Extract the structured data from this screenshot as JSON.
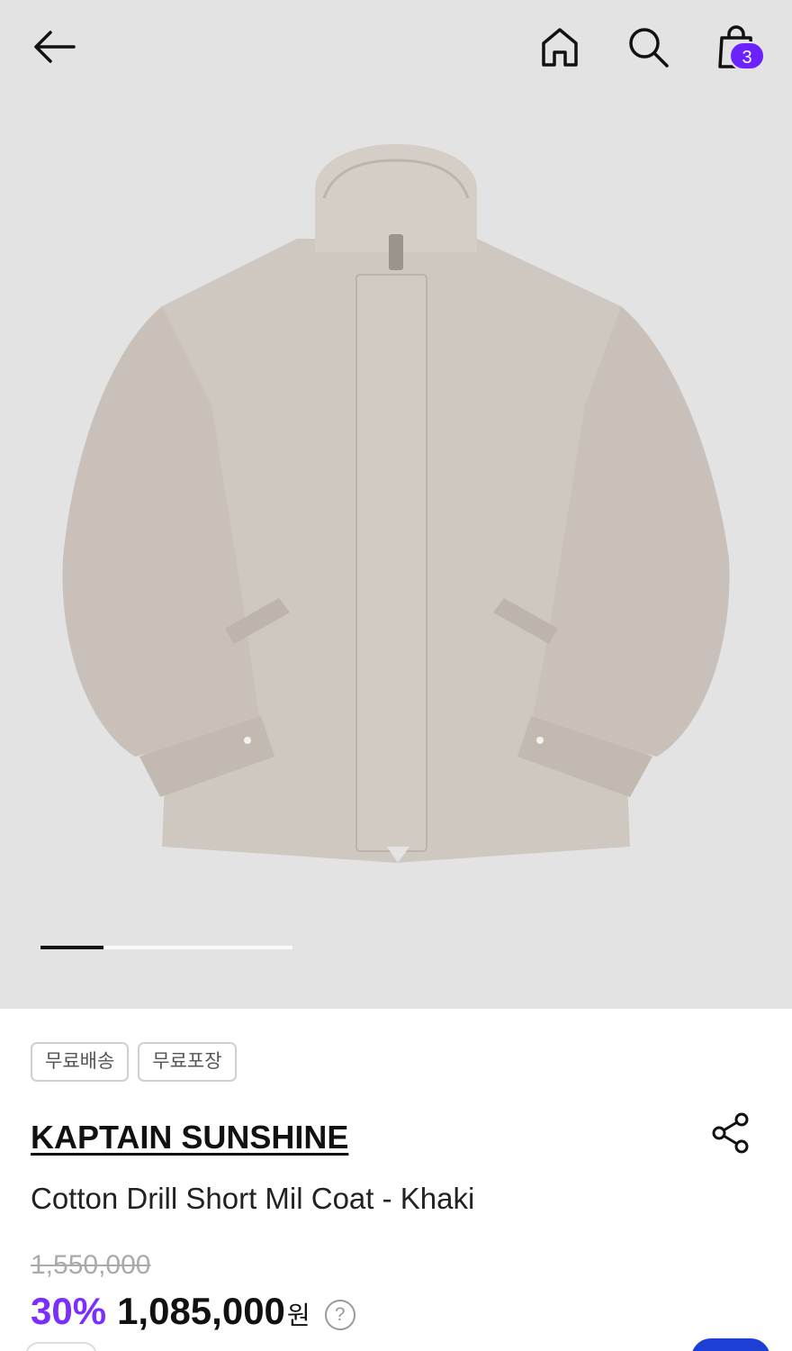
{
  "header": {
    "back_icon": "back-arrow-icon",
    "home_icon": "home-icon",
    "search_icon": "search-icon",
    "cart_icon": "shopping-bag-icon",
    "cart_count": "3"
  },
  "gallery": {
    "image_subject": "stone-colored cotton drill short coat with high zip collar",
    "indicator_progress": 0.25
  },
  "badges": [
    "무료배송",
    "무료포장"
  ],
  "product": {
    "brand": "KAPTAIN SUNSHINE",
    "name": "Cotton Drill Short Mil Coat - Khaki",
    "original_price": "1,550,000",
    "discount": "30%",
    "sale_price": "1,085,000",
    "currency": "원",
    "help_icon": "question-circle-icon",
    "share_icon": "share-icon"
  },
  "colors": {
    "accent": "#7b2eff",
    "badge_bg": "#6c22ff",
    "hero_bg": "#e3e3e3",
    "fab": "#1d3fd6"
  }
}
